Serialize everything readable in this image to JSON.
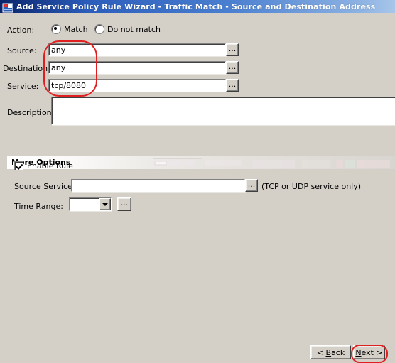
{
  "window": {
    "title": "Add Service Policy Rule Wizard - Traffic Match - Source and Destination Address",
    "icon": "wizard-icon"
  },
  "form": {
    "action": {
      "label": "Action:",
      "options": [
        {
          "label": "Match",
          "selected": true
        },
        {
          "label": "Do not match",
          "selected": false
        }
      ]
    },
    "rows": [
      {
        "label": "Source:",
        "value": "any",
        "browse": "..."
      },
      {
        "label": "Destination:",
        "value": "any",
        "browse": "..."
      },
      {
        "label": "Service:",
        "value": "tcp/8080",
        "browse": "..."
      }
    ],
    "description": {
      "label": "Description:",
      "value": ""
    }
  },
  "more_options": {
    "title": "More Options",
    "enable_rule": {
      "label": "Enable Rule",
      "checked": true
    },
    "source_service": {
      "label": "Source Service:",
      "value": "",
      "browse": "...",
      "hint": "(TCP or UDP service only)"
    },
    "time_range": {
      "label": "Time Range:",
      "value": "",
      "browse": "..."
    }
  },
  "footer": {
    "back_prefix": "< ",
    "back_key": "B",
    "back_suffix": "ack",
    "next_key": "N",
    "next_suffix": "ext >"
  },
  "annotations": {
    "fields_highlight": "red-oval-around-source-destination-service-values",
    "next_highlight": "red-oval-around-next-button",
    "color": "#e02020"
  }
}
